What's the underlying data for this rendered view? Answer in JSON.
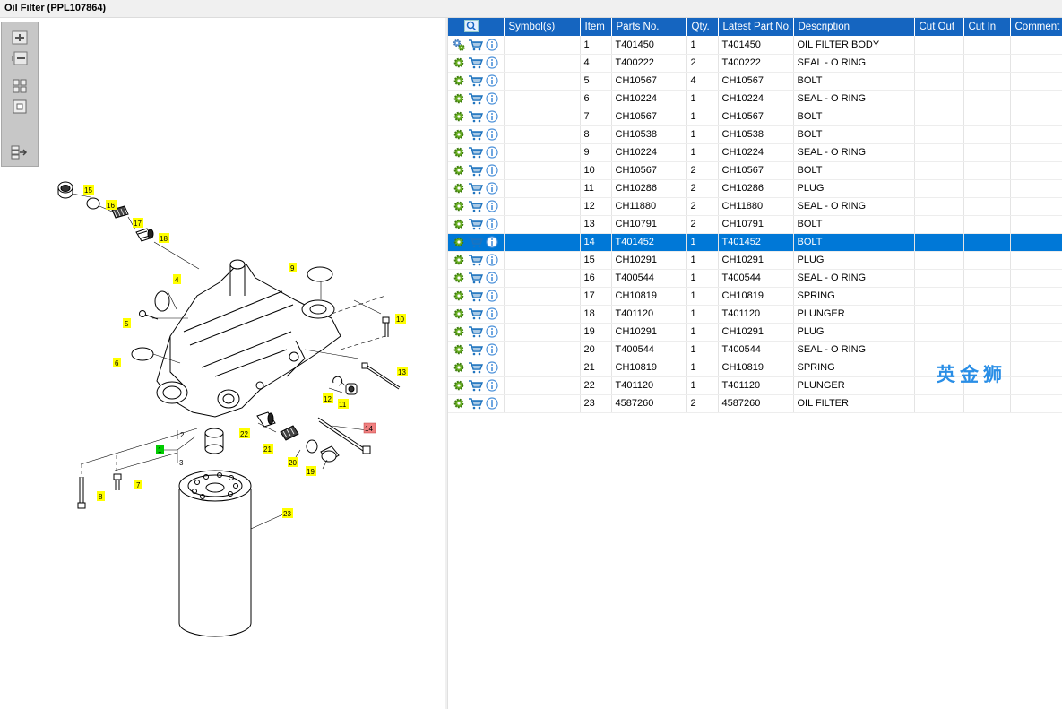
{
  "window": {
    "title": "Oil Filter (PPL107864)"
  },
  "columns": {
    "symbols": "Symbol(s)",
    "item": "Item",
    "parts_no": "Parts No.",
    "qty": "Qty.",
    "latest": "Latest Part No.",
    "description": "Description",
    "cut_out": "Cut Out",
    "cut_in": "Cut In",
    "comment": "Comment"
  },
  "rows": [
    {
      "item": "1",
      "part": "T401450",
      "qty": "1",
      "latest": "T401450",
      "desc": "OIL FILTER BODY",
      "selected": false,
      "multi": true
    },
    {
      "item": "4",
      "part": "T400222",
      "qty": "2",
      "latest": "T400222",
      "desc": "SEAL - O RING",
      "selected": false
    },
    {
      "item": "5",
      "part": "CH10567",
      "qty": "4",
      "latest": "CH10567",
      "desc": "BOLT",
      "selected": false
    },
    {
      "item": "6",
      "part": "CH10224",
      "qty": "1",
      "latest": "CH10224",
      "desc": "SEAL - O RING",
      "selected": false
    },
    {
      "item": "7",
      "part": "CH10567",
      "qty": "1",
      "latest": "CH10567",
      "desc": "BOLT",
      "selected": false
    },
    {
      "item": "8",
      "part": "CH10538",
      "qty": "1",
      "latest": "CH10538",
      "desc": "BOLT",
      "selected": false
    },
    {
      "item": "9",
      "part": "CH10224",
      "qty": "1",
      "latest": "CH10224",
      "desc": "SEAL - O RING",
      "selected": false
    },
    {
      "item": "10",
      "part": "CH10567",
      "qty": "2",
      "latest": "CH10567",
      "desc": "BOLT",
      "selected": false
    },
    {
      "item": "11",
      "part": "CH10286",
      "qty": "2",
      "latest": "CH10286",
      "desc": "PLUG",
      "selected": false
    },
    {
      "item": "12",
      "part": "CH11880",
      "qty": "2",
      "latest": "CH11880",
      "desc": "SEAL - O RING",
      "selected": false
    },
    {
      "item": "13",
      "part": "CH10791",
      "qty": "2",
      "latest": "CH10791",
      "desc": "BOLT",
      "selected": false
    },
    {
      "item": "14",
      "part": "T401452",
      "qty": "1",
      "latest": "T401452",
      "desc": "BOLT",
      "selected": true
    },
    {
      "item": "15",
      "part": "CH10291",
      "qty": "1",
      "latest": "CH10291",
      "desc": "PLUG",
      "selected": false
    },
    {
      "item": "16",
      "part": "T400544",
      "qty": "1",
      "latest": "T400544",
      "desc": "SEAL - O RING",
      "selected": false
    },
    {
      "item": "17",
      "part": "CH10819",
      "qty": "1",
      "latest": "CH10819",
      "desc": "SPRING",
      "selected": false
    },
    {
      "item": "18",
      "part": "T401120",
      "qty": "1",
      "latest": "T401120",
      "desc": "PLUNGER",
      "selected": false
    },
    {
      "item": "19",
      "part": "CH10291",
      "qty": "1",
      "latest": "CH10291",
      "desc": "PLUG",
      "selected": false
    },
    {
      "item": "20",
      "part": "T400544",
      "qty": "1",
      "latest": "T400544",
      "desc": "SEAL - O RING",
      "selected": false
    },
    {
      "item": "21",
      "part": "CH10819",
      "qty": "1",
      "latest": "CH10819",
      "desc": "SPRING",
      "selected": false
    },
    {
      "item": "22",
      "part": "T401120",
      "qty": "1",
      "latest": "T401120",
      "desc": "PLUNGER",
      "selected": false
    },
    {
      "item": "23",
      "part": "4587260",
      "qty": "2",
      "latest": "4587260",
      "desc": "OIL FILTER",
      "selected": false
    }
  ],
  "diagram": {
    "callouts": [
      "15",
      "16",
      "17",
      "18",
      "4",
      "5",
      "9",
      "10",
      "6",
      "13",
      "12",
      "11",
      "14",
      "22",
      "21",
      "20",
      "19",
      "1",
      "8",
      "7",
      "23"
    ],
    "unlabeled_refs": [
      "2",
      "3"
    ],
    "highlighted_callout": "14",
    "group_callout": "1"
  },
  "toolbar": {
    "icons": [
      "zoom-in-icon",
      "zoom-out-icon",
      "fit-all-icon",
      "fit-window-icon",
      "export-icon"
    ]
  },
  "watermark": "英金狮",
  "colors": {
    "header": "#1565c0",
    "selection": "#0078d7",
    "callout_yellow": "#ffff00",
    "callout_selected": "#f08080",
    "callout_green": "#00cc00",
    "gear_green": "#6ab023",
    "cart_blue": "#1e73be",
    "info_blue": "#4a90d9"
  }
}
